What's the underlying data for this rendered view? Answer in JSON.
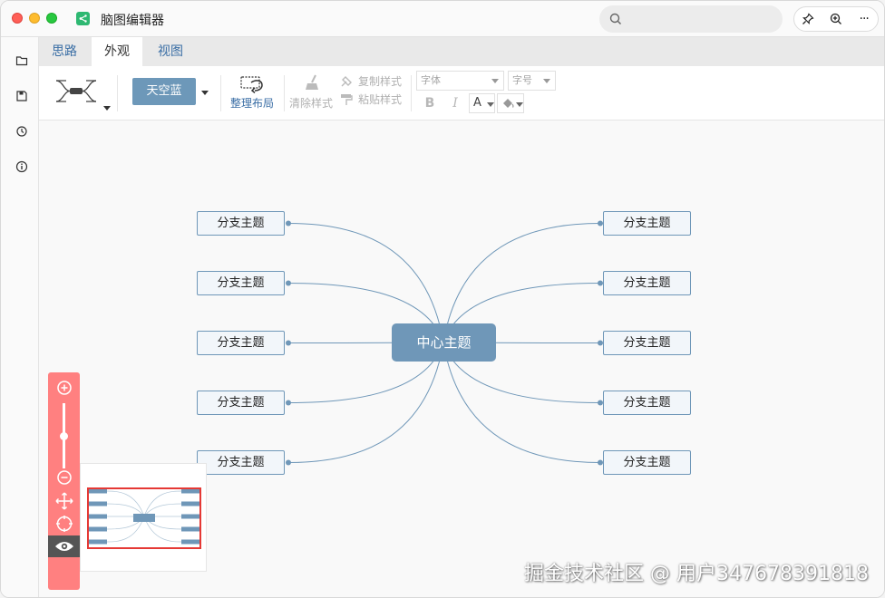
{
  "app": {
    "title": "脑图编辑器"
  },
  "search": {
    "placeholder": ""
  },
  "titlebar_buttons": {
    "pin": "pin-icon",
    "zoom": "zoom-in-icon",
    "more": "more-icon",
    "more_text": "···"
  },
  "sidebar": {
    "items": [
      "folder-icon",
      "save-icon",
      "history-icon",
      "info-icon"
    ]
  },
  "tabs": [
    {
      "label": "思路",
      "active": false
    },
    {
      "label": "外观",
      "active": true
    },
    {
      "label": "视图",
      "active": false
    }
  ],
  "ribbon": {
    "theme_label": "天空蓝",
    "arrange_label": "整理布局",
    "clear_style_label": "清除样式",
    "copy_style_label": "复制样式",
    "paste_style_label": "粘贴样式",
    "font_placeholder": "字体",
    "fontsize_placeholder": "字号",
    "bold": "B",
    "italic": "I",
    "color": "A"
  },
  "mindmap": {
    "center": "中心主题",
    "left_branches": [
      "分支主题",
      "分支主题",
      "分支主题",
      "分支主题",
      "分支主题"
    ],
    "right_branches": [
      "分支主题",
      "分支主题",
      "分支主题",
      "分支主题",
      "分支主题"
    ]
  },
  "zoom_panel": {
    "zoom_level": 0.5
  },
  "watermark": "掘金技术社区 @ 用户347678391818",
  "colors": {
    "accent": "#6f97b8",
    "zoom_panel": "#ff8080",
    "minimap_frame": "#e53935",
    "link": "#3a6ea5"
  }
}
